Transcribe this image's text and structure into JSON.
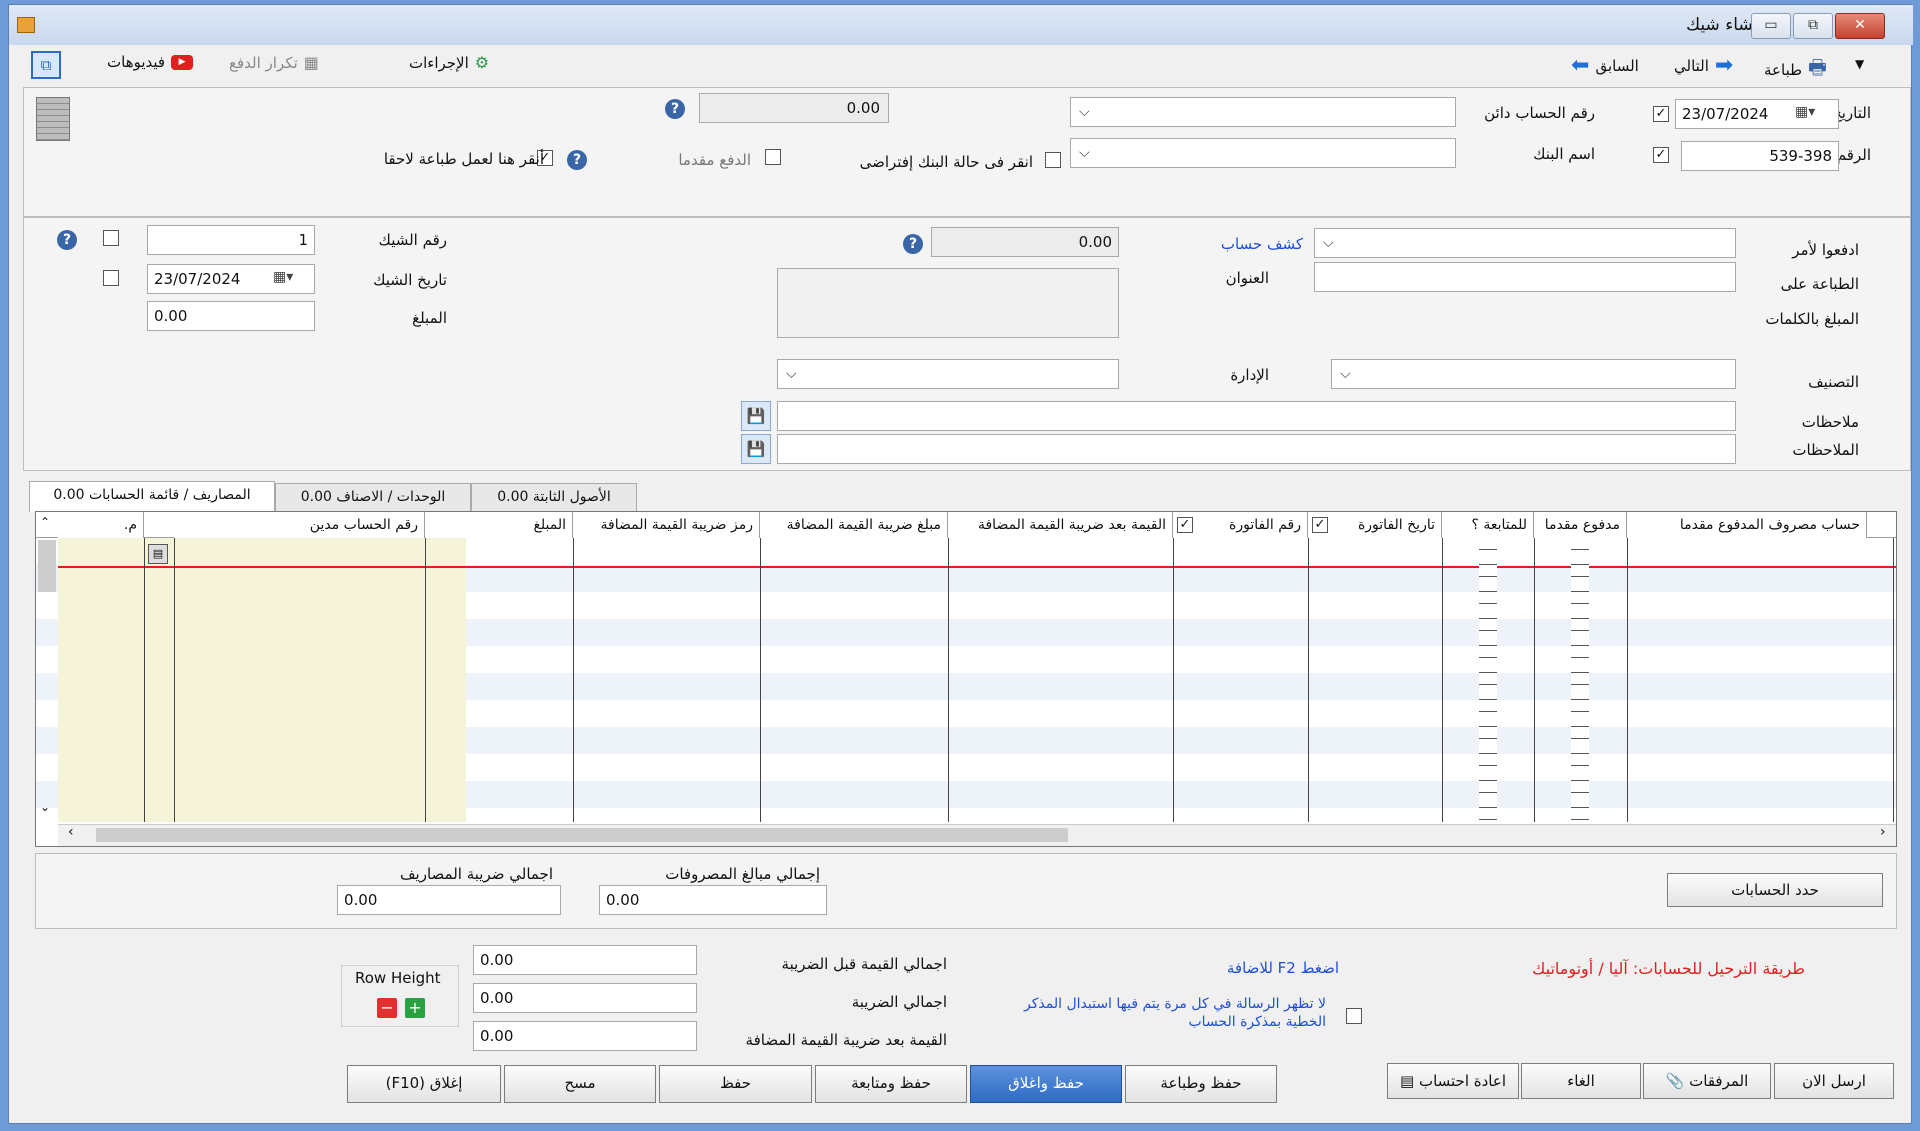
{
  "window": {
    "title": "إنشاء شيك",
    "minimize": "▭",
    "restore": "⧉",
    "close": "✕"
  },
  "toolbar": {
    "print": "طباعة",
    "next": "التالي",
    "prev": "السابق",
    "actions": "الإجراءات",
    "repeat_payment": "تكرار الدفع",
    "videos": "فيديوهات"
  },
  "header": {
    "date_label": "التاريخ",
    "date_value": "23/07/2024",
    "number_label": "الرقم",
    "number_value": "539-398",
    "credit_account_label": "رقم  الحساب دائن",
    "bank_name_label": "اسم البنك",
    "amount_value": "0.00",
    "prepaid_label": "الدفع مقدما",
    "default_bank_label": "انقر فى حالة البنك إفتراضى",
    "print_later_label": "أنقر هنا لعمل طباعة لاحقا"
  },
  "cheque": {
    "pay_to_label": "ادفعوا لأمر",
    "print_on_label": "الطباعة على",
    "amount_words_label": "المبلغ بالكلمات",
    "statement_link": "كشف حساب",
    "address_label": "العنوان",
    "balance_value": "0.00",
    "cheque_no_label": "رقم  الشيك",
    "cheque_no_value": "1",
    "cheque_date_label": "تاريخ الشيك",
    "cheque_date_value": "23/07/2024",
    "amount_label": "المبلغ",
    "amount_value": "0.00",
    "classification_label": "التصنيف",
    "management_label": "الإدارة",
    "notes_label": "ملاحظات",
    "notes2_label": "الملاحظات"
  },
  "tabs": [
    {
      "label": "المصاريف / قائمة الحسابات",
      "value": "0.00"
    },
    {
      "label": "الوحدات / الاصناف",
      "value": "0.00"
    },
    {
      "label": "الأصول الثابتة",
      "value": "0.00"
    }
  ],
  "grid": {
    "columns": [
      "حساب مصروف المدفوع مقدما",
      "مدفوع مقدما",
      "للمتابعة ؟",
      "تاريخ الفاتورة",
      "رقم الفاتورة",
      "القيمة بعد ضريبة القيمة المضافة",
      "مبلغ ضريبة القيمة المضافة",
      "رمز ضريبة القيمة المضافة",
      "المبلغ",
      "رقم الحساب مدين",
      "م."
    ]
  },
  "totals": {
    "set_accounts": "حدد الحسابات",
    "total_expenses_label": "إجمالي مبالغ المصروفات",
    "total_expenses_value": "0.00",
    "total_tax_label": "اجمالي ضريبة المصاريف",
    "total_tax_value": "0.00"
  },
  "summary": {
    "posting_method": "طريقة الترحيل للحسابات: آليا / أوتوماتيك",
    "f2_hint": "اضغط F2 للاضافة",
    "dont_show_msg": "لا تظهر الرسالة في كل مرة يتم فيها استبدال المذكر الخطية بمذكرة الحساب",
    "before_tax_label": "اجمالي القيمة قبل الضريبة",
    "before_tax_value": "0.00",
    "tax_label": "اجمالي الضريبة",
    "tax_value": "0.00",
    "after_tax_label": "القيمة بعد ضريبة القيمة المضافة",
    "after_tax_value": "0.00",
    "row_height": "Row Height"
  },
  "buttons": {
    "send_now": "ارسل الان",
    "attachments": "المرفقات",
    "cancel": "الغاء",
    "recalc": "اعادة احتساب",
    "save_print": "حفظ وطباعة",
    "save_close": "حفظ واغلاق",
    "save_follow": "حفظ ومتابعة",
    "save": "حفظ",
    "clear": "مسح",
    "close": "إغلاق (F10)"
  },
  "colors": {
    "accent": "#2f6bc5",
    "link": "#1f4fd6",
    "red_text": "#e02020"
  }
}
